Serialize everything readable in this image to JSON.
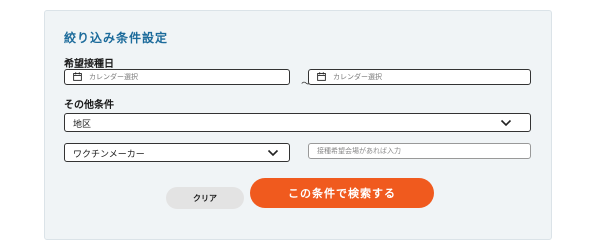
{
  "panel": {
    "title": "絞り込み条件設定"
  },
  "date_section": {
    "label": "希望接種日",
    "from_placeholder": "カレンダー選択",
    "separator": "～",
    "to_placeholder": "カレンダー選択"
  },
  "other_section": {
    "label": "その他条件",
    "region_select": "地区",
    "vaccine_select": "ワクチンメーカー",
    "venue_placeholder": "接種希望会場があれば入力"
  },
  "buttons": {
    "clear_label": "クリア",
    "search_label": "この条件で検索する"
  },
  "colors": {
    "title": "#1c6b9b",
    "search_button": "#f05a1e",
    "clear_button": "#e3e3e3",
    "panel_bg": "#f0f4f6"
  },
  "icons": {
    "date_from": "calendar-icon",
    "date_to": "calendar-icon",
    "region_dropdown": "chevron-down-icon",
    "vaccine_dropdown": "chevron-down-icon"
  }
}
